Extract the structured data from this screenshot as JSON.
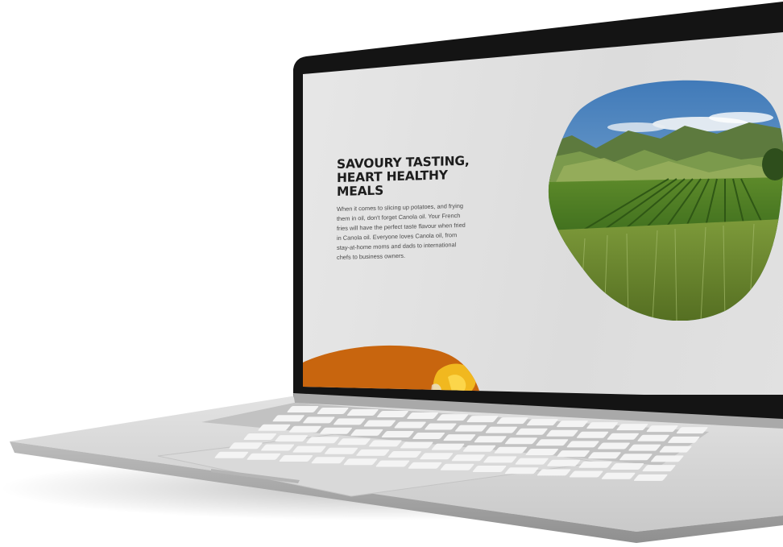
{
  "section": {
    "headline": "SAVOURY TASTING, HEART HEALTHY MEALS",
    "body": "When it comes to slicing up potatoes, and frying them in oil, don't forget Canola oil. Your French fries will have the perfect taste flavour when fried in Canola oil. Everyone loves Canola oil, from stay-at-home moms and dads to international chefs to business owners."
  },
  "images": {
    "hero": "landscape-vineyard-mountains-image",
    "bottom": "orange-food-image"
  },
  "colors": {
    "screen_bg": "#e3e3e3",
    "bezel": "#111111",
    "laptop_body": "#d4d4d4",
    "accent_orange": "#c8650e",
    "headline": "#1d1d1d"
  }
}
